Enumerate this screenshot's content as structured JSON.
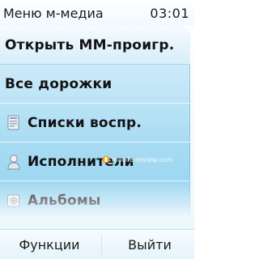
{
  "status_bar": {
    "title": "Меню м-медиа",
    "time": "03:01"
  },
  "menu": {
    "items": [
      {
        "label": "Открыть ММ-проигр.",
        "icon": null,
        "selected": true
      },
      {
        "label": "Все дорожки",
        "icon": null,
        "selected": false
      },
      {
        "label": "Списки воспр.",
        "icon": "playlist-icon",
        "selected": false
      },
      {
        "label": "Исполнители",
        "icon": "artist-icon",
        "selected": false
      },
      {
        "label": "Альбомы",
        "icon": "album-icon",
        "selected": false
      }
    ]
  },
  "softkeys": {
    "left": "Функции",
    "right": "Выйти"
  },
  "watermark": {
    "text": "mobile-review.com"
  },
  "colors": {
    "selected_row": "#e6f5fc",
    "menu_gradient_top": "#dff2fc",
    "menu_gradient_bottom": "#93d2f0",
    "text": "#131313"
  }
}
